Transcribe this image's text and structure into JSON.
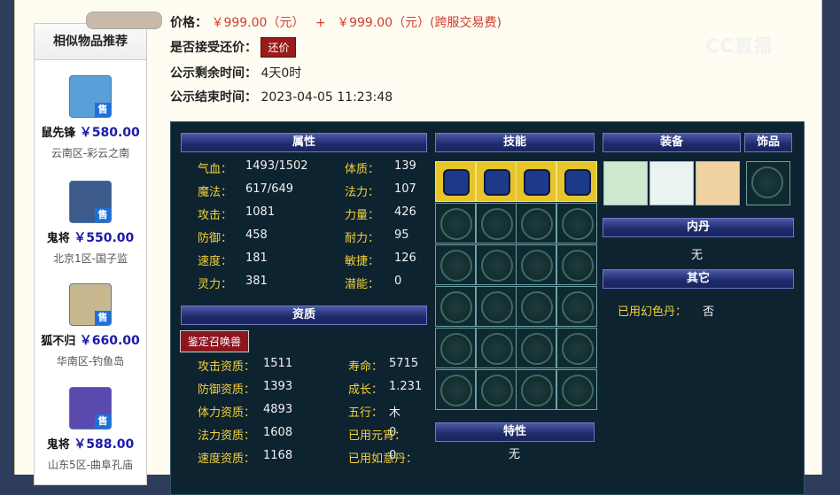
{
  "header": {
    "price_label": "价格：",
    "price_main": "￥999.00（元）",
    "price_plus": "+",
    "price_fee": "￥999.00（元）(跨服交易费)",
    "bargain_label": "是否接受还价：",
    "bargain_button": "还价",
    "remain_label": "公示剩余时间：",
    "remain_value": "4天0时",
    "end_label": "公示结束时间：",
    "end_value": "2023-04-05 11:23:48",
    "watermark": "CC直播"
  },
  "sidebar": {
    "title": "相似物品推荐",
    "sell_badge": "售",
    "items": [
      {
        "name": "鼠先锋",
        "price": "￥580.00",
        "server": "云南区-彩云之南",
        "color": "#5aa0d8"
      },
      {
        "name": "鬼将",
        "price": "￥550.00",
        "server": "北京1区-国子监",
        "color": "#3c5a8a"
      },
      {
        "name": "狐不归",
        "price": "￥660.00",
        "server": "华南区-钓鱼岛",
        "color": "#c8b890"
      },
      {
        "name": "鬼将",
        "price": "￥588.00",
        "server": "山东5区-曲阜孔庙",
        "color": "#5a4ab0"
      }
    ]
  },
  "pet": {
    "attributes_title": "属性",
    "attributes": [
      {
        "k": "气血：",
        "v": "1493/1502",
        "k2": "体质：",
        "v2": "139"
      },
      {
        "k": "魔法：",
        "v": "617/649",
        "k2": "法力：",
        "v2": "107"
      },
      {
        "k": "攻击：",
        "v": "1081",
        "k2": "力量：",
        "v2": "426"
      },
      {
        "k": "防御：",
        "v": "458",
        "k2": "耐力：",
        "v2": "95"
      },
      {
        "k": "速度：",
        "v": "181",
        "k2": "敏捷：",
        "v2": "126"
      },
      {
        "k": "灵力：",
        "v": "381",
        "k2": "潜能：",
        "v2": "0"
      }
    ],
    "aptitude_title": "资质",
    "identify_button": "鉴定召唤兽",
    "aptitudes": [
      {
        "k": "攻击资质：",
        "v": "1511",
        "k2": "寿命：",
        "v2": "5715"
      },
      {
        "k": "防御资质：",
        "v": "1393",
        "k2": "成长：",
        "v2": "1.231"
      },
      {
        "k": "体力资质：",
        "v": "4893",
        "k2": "五行：",
        "v2": "木"
      },
      {
        "k": "法力资质：",
        "v": "1608",
        "k2": "已用元宵：",
        "v2": "0"
      },
      {
        "k": "速度资质：",
        "v": "1168",
        "k2": "已用如意丹：",
        "v2": "0"
      }
    ],
    "skills_title": "技能",
    "features_title": "特性",
    "features_value": "无",
    "equip_title": "装备",
    "accessory_title": "饰品",
    "neidan_title": "内丹",
    "neidan_value": "无",
    "other_title": "其它",
    "other_label": "已用幻色丹：",
    "other_value": "否"
  }
}
